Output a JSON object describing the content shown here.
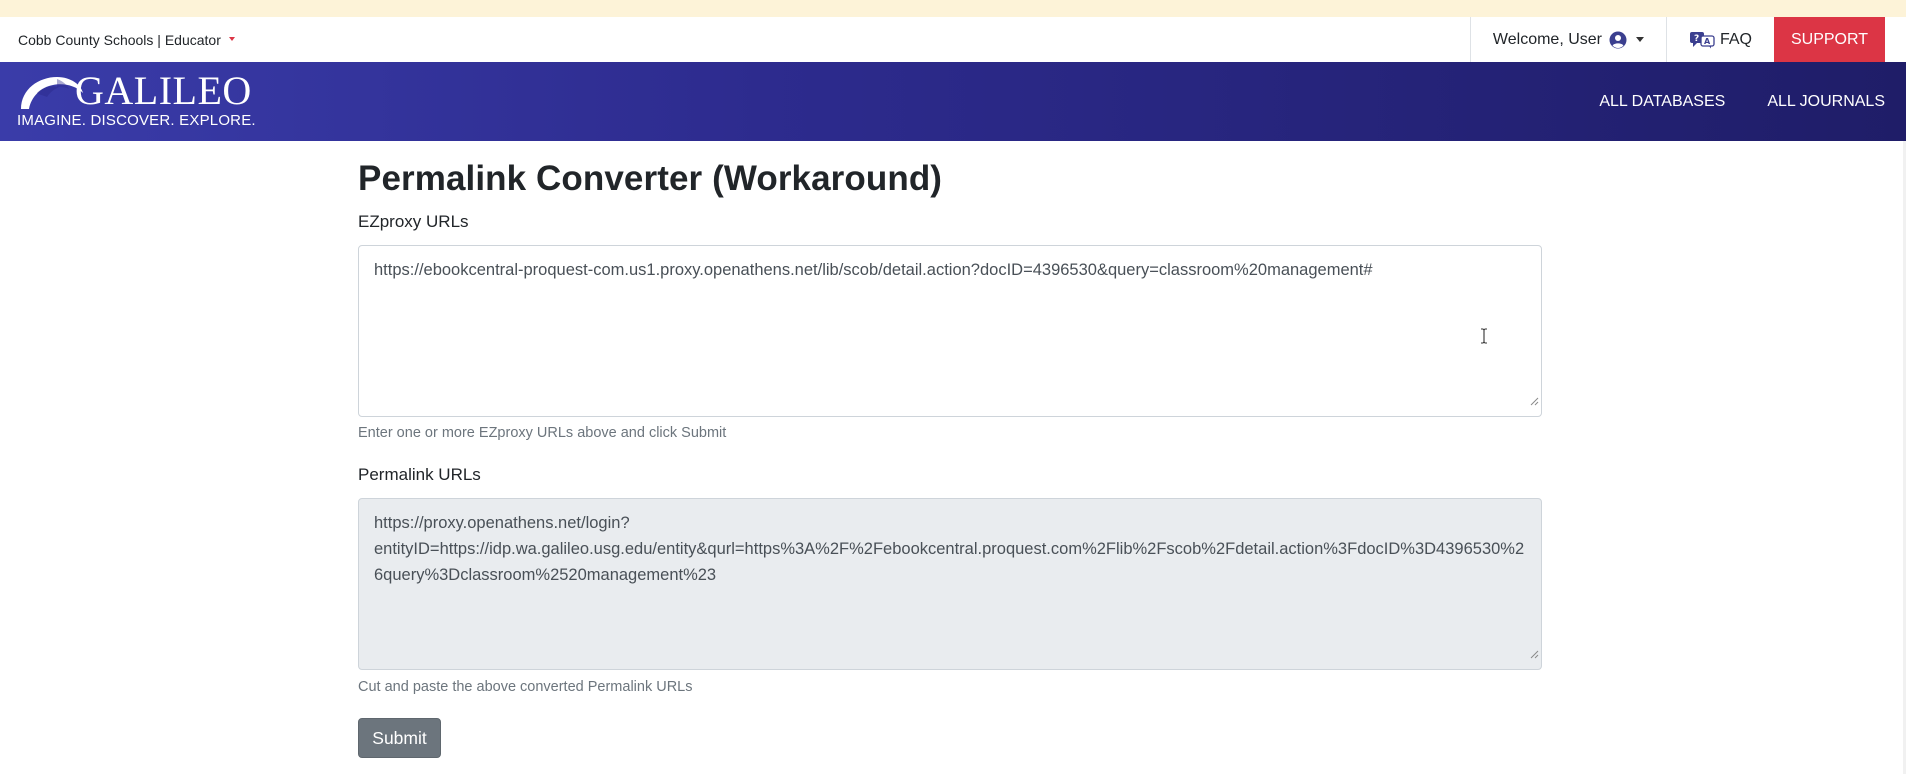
{
  "utility_bar": {
    "institution": "Cobb County Schools | Educator",
    "welcome": "Welcome, User",
    "faq": "FAQ",
    "support": "SUPPORT"
  },
  "navbar": {
    "brand_name": "GALILEO",
    "brand_tagline": "IMAGINE. DISCOVER. EXPLORE.",
    "links": [
      "ALL DATABASES",
      "ALL JOURNALS"
    ]
  },
  "form": {
    "title": "Permalink Converter (Workaround)",
    "ezproxy": {
      "label": "EZproxy URLs",
      "value": "https://ebookcentral-proquest-com.us1.proxy.openathens.net/lib/scob/detail.action?docID=4396530&query=classroom%20management#",
      "help": "Enter one or more EZproxy URLs above and click Submit"
    },
    "permalink": {
      "label": "Permalink URLs",
      "value_line1": "https://proxy.openathens.net/login?",
      "value_line2": "entityID=https://idp.wa.galileo.usg.edu/entity&qurl=https%3A%2F%2Febookcentral.proquest.com%2Flib%2Fscob%2Fdetail.action%3FdocID%3D4396530%26query%3Dclassroom%2520management%23",
      "help": "Cut and paste the above converted Permalink URLs"
    },
    "submit_label": "Submit"
  },
  "colors": {
    "support_red": "#dc3545",
    "navbar_blue": "#2d2b8e",
    "submit_gray": "#6c757d",
    "banner_yellow": "#fdf3d8"
  },
  "icons": [
    "user-circle-icon",
    "faq-chat-icon",
    "galileo-globe-icon",
    "resize-grip-icon",
    "text-cursor-icon"
  ]
}
